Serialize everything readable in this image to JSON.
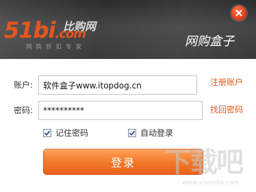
{
  "header": {
    "logo_main": "51bi",
    "logo_dotcom": ".com",
    "logo_cn": "比购网",
    "logo_sub": "网购折扣专家",
    "title": "网购盒子"
  },
  "form": {
    "account_label": "账户:",
    "account_value": "软件盒子www.itopdog.cn",
    "register_link": "注册账户",
    "password_label": "密码:",
    "password_value": "**********",
    "recover_link": "找回密码",
    "remember_label": "记住密码",
    "remember_checked": true,
    "autologin_label": "自动登录",
    "autologin_checked": true,
    "login_button": "登录"
  },
  "watermark": {
    "text": "下载吧",
    "url": "www.xiazaiba.com"
  },
  "colors": {
    "accent": "#e8561e",
    "link": "#e25a1c",
    "header_bg": "#3b3b3b",
    "button": "#f27a2a"
  }
}
